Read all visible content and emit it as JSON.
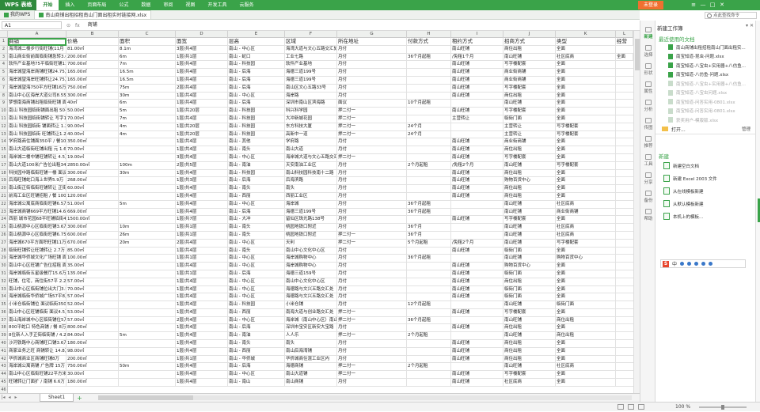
{
  "app": {
    "logo": "WPS 表格",
    "menu": [
      "开始",
      "插入",
      "页面布局",
      "公式",
      "数据",
      "审阅",
      "视图",
      "开发工具",
      "云服务"
    ],
    "active_menu": "开始",
    "login_label": "未登录",
    "window_controls": [
      "≡",
      "—",
      "□",
      "✕"
    ]
  },
  "tabs": [
    {
      "label": "我的WPS"
    },
    {
      "label": "南山商铺出租招租南山门面出租实时链接网.xlsx"
    }
  ],
  "command_search": {
    "placeholder": "点此查找命令"
  },
  "formula_bar": {
    "cell_ref": "A1",
    "value": "商铺",
    "icons": [
      "⊙",
      "fx"
    ]
  },
  "grid": {
    "columns": [
      "A",
      "B",
      "C",
      "D",
      "E",
      "F",
      "G",
      "H",
      "I",
      "J",
      "K",
      "L"
    ],
    "header_row": [
      "商铺",
      "价格",
      "面积",
      "面宽",
      "层高",
      "区域",
      "所在地址",
      "付款方式",
      "租约方式",
      "招商方式",
      "类型",
      "经营"
    ],
    "rows": [
      [
        "海湾城二楼步行街旺铺(11月",
        "81.00㎡",
        "8.1m",
        "3层/共4层",
        "南山 - 中心区",
        "海湾大道与文心五路交汇处",
        "月付",
        "",
        "南山旺铺",
        "商住出租",
        "全面"
      ],
      [
        "南山商业街前面临街铺急转3.6万",
        "200.00㎡",
        "6m",
        "1层/共1层",
        "南山 - 蛇口",
        "工业七路",
        "月付",
        "36个月起租",
        "/免租1个月",
        "南山旺铺",
        "社区底商",
        "全面"
      ],
      [
        "软件产业基地75平临街旺铺13万",
        "700.00㎡",
        "7m",
        "1层/共4层",
        "南山 - 科技园",
        "软件产业基地",
        "月付",
        "",
        "南山旺铺",
        "写字楼配套",
        "全面"
      ],
      [
        "海岸城望海岸商铺旺铺24.75万",
        "165.00㎡",
        "16.5m",
        "1层/共4层",
        "南山 - 后海",
        "海德三道199号",
        "月付",
        "",
        "南山旺铺",
        "商业街商铺",
        "全面"
      ],
      [
        "海岸城望海岸旺铺转让24.75万",
        "165.00㎡",
        "16.5m",
        "1层/共4层",
        "南山 - 后海",
        "海德三道199号",
        "月付",
        "",
        "南山旺铺",
        "商业街商铺",
        "全面"
      ],
      [
        "海岸城望海750平方旺铺16万",
        "750.00㎡",
        "75m",
        "2层/共4层",
        "南山 - 后海",
        "南山区文心五路33号",
        "月付",
        "",
        "南山旺铺",
        "写字楼配套",
        "全面"
      ],
      [
        "南山中心区海岸大道公司8.55万",
        "300.00㎡",
        "30m",
        "1层/共4层",
        "南山 - 中心区",
        "海岸路",
        "月付",
        "",
        "南山旺铺",
        "商住出租",
        "全面"
      ],
      [
        "梦想南海商铺出租临街旺铺 面议",
        "40㎡",
        "6m",
        "1层/共4层",
        "南山 - 后海",
        "深圳市南山区滨海路",
        "面议",
        "10个月起租",
        "",
        "南山旺铺",
        "全面"
      ],
      [
        "南山 科技园临街铺面出租 50平 2.4万",
        "50.00㎡",
        "5m",
        "1层/共20层",
        "南山 - 科技园",
        "科兴科学园",
        "押二付一",
        "",
        "南山旺铺",
        "写字楼配套",
        "全面"
      ],
      [
        "南山 科技园临街铺转让 写字1.6万",
        "70.00㎡",
        "7m",
        "1层/共4层",
        "南山 - 科技园",
        "大冲新城花园",
        "押二付一",
        "",
        "主营转让",
        "临街门面",
        "全面"
      ],
      [
        "南山 科技园临街 铺面转让 1.2万",
        "90.00㎡",
        "4m",
        "1层/共20层",
        "南山 - 科技园",
        "东方科技大厦",
        "押二付一",
        "24个月",
        "",
        "主营转让",
        "写字楼配套"
      ],
      [
        "南山 科技园临街 旺铺转让1.2万",
        "40.00㎡",
        "4m",
        "1层/共20层",
        "南山 - 科技园",
        "高新中一道",
        "押二付一",
        "24个月",
        "",
        "主营转让",
        "写字楼配套"
      ],
      [
        "学府路商住铺面350平 / 餐10.5万",
        "350.00㎡",
        "",
        "1层/共4层",
        "南山 - 其他",
        "学府路",
        "月付",
        "",
        "南山旺铺",
        "商业街商铺",
        "全面"
      ],
      [
        "南山大道临街旺铺出租 元 1.6万",
        "70.00㎡",
        "",
        "1层/共4层",
        "南山 - 南头",
        "南山大道",
        "月付",
        "",
        "南山旺铺",
        "商住出租",
        "全面"
      ],
      [
        "海岸城二楼中铺旺铺转让 4.5万",
        "19.00㎡",
        "",
        "3层/共4层",
        "南山 - 中心区",
        "海岸城大道与文心五路交汇处",
        "押二付一",
        "",
        "南山旺铺",
        "写字楼配套",
        "全面"
      ],
      [
        "南山大道100米广告位出租34万",
        "2850.00㎡",
        "100m",
        "2层/共5层",
        "南山 - 南油",
        "天安南油工业区",
        "月付",
        "2个月起租",
        "/免租2个月",
        "南山旺铺",
        "写字楼配套"
      ],
      [
        "科技园中路临街旺铺一楼 面议",
        "300.00㎡",
        "30m",
        "1层/共4层",
        "南山 - 科技园",
        "南山科技园科技南十二路",
        "月付",
        "",
        "南山旺铺",
        "商住出租",
        "全面"
      ],
      [
        "后海旺铺蛇口海上世界5.9万",
        "268.00㎡",
        "",
        "1层/共3层",
        "南山 - 后海",
        "后海滨路",
        "月付",
        "",
        "南山旺铺",
        "购物百货中心",
        "全面"
      ],
      [
        "南山街正街临街旺铺转让 正街2万",
        "60.00㎡",
        "",
        "1层/共4层",
        "南山 - 南头",
        "南头",
        "月付",
        "",
        "南山旺铺",
        "商住出租",
        "全面"
      ],
      [
        "前海工业区旺铺招租 / 餐 10000",
        "120.00㎡",
        "",
        "1层/共4层",
        "南山 - 西丽",
        "西丽工业区",
        "月付",
        "",
        "南山旺铺",
        "商住出租",
        "全面"
      ],
      [
        "海岸城公寓底商临街旺铺6.5万",
        "51.00㎡",
        "5m",
        "1层/共4层",
        "南山 - 中心区",
        "海岸城",
        "月付",
        "36个月起租",
        "",
        "南山旺铺",
        "社区底商"
      ],
      [
        "海岸城商铺669平方旺铺14.65万",
        "669.00㎡",
        "",
        "1层/共4层",
        "南山 - 后海",
        "海德三道199号",
        "月付",
        "36个月起租",
        "",
        "南山旺铺",
        "商业街商铺"
      ],
      [
        "西丽 城市花园68平旺铺临街4.5万",
        "1500.00㎡",
        "",
        "1层/共7层",
        "南山 - 大冲",
        "留仙区珠光路138号",
        "月付",
        "",
        "南山旺铺",
        "写字楼配套",
        "全面"
      ],
      [
        "南山桃源中心区临街旺铺3.6万",
        "300.00㎡",
        "10m",
        "1层/共1层",
        "南山 - 南头",
        "桃园地铁口附近",
        "月付",
        "36个月",
        "",
        "南山旺铺",
        "社区底商"
      ],
      [
        "南山桃源中心区临街旺铺6.75万",
        "600.00㎡",
        "26m",
        "1层/共1层",
        "南山 - 南头",
        "桃园地铁口附近",
        "押二付一",
        "36个月",
        "",
        "南山旺铺",
        "社区底商"
      ],
      [
        "海岸城670平方面积旺铺11万",
        "670.00㎡",
        "20m",
        "2层/共4层",
        "南山 - 中心区",
        "天利",
        "押二付一",
        "5个月起租",
        "/免租2个月",
        "南山旺铺",
        "写字楼配套"
      ],
      [
        "临街旺铺转让旺铺转让 2.7万",
        "85.00㎡",
        "",
        "1层/共4层",
        "南山 - 南头",
        "南山中心文化中心区",
        "月付",
        "",
        "南山旺铺",
        "临街门面",
        "全面"
      ],
      [
        "海岸城华侨城文化广场旺铺 面议",
        "100.00㎡",
        "",
        "1层/共1层",
        "南山 - 中心区",
        "海岸城购物中心",
        "月付",
        "36个月起租",
        "",
        "南山旺铺",
        "购物百货中心"
      ],
      [
        "南山中心区旺铺广告位招租 面议",
        "35.00㎡",
        "",
        "1层/共4层",
        "南山 - 中心区",
        "海岸城购物中心",
        "月付",
        "",
        "南山旺铺",
        "购物百货中心",
        "全面"
      ],
      [
        "海岸城临街五星级餐厅15.6万",
        "135.00㎡",
        "",
        "1层/共1层",
        "南山 - 后海",
        "海德三道159号",
        "月付",
        "",
        "南山旺铺",
        "临街门面",
        "全面"
      ],
      [
        "旺铺，住宅，商住街57平 2.2万",
        "57.00㎡",
        "",
        "1层/共4层",
        "南山 - 中心区",
        "南山中心文化中心区",
        "月付",
        "",
        "南山旺铺",
        "商住出租",
        "全面"
      ],
      [
        "南山中心区临街铺位出大门3.5万",
        "70.00㎡",
        "",
        "1层/共4层",
        "南山 - 中心区",
        "海德路与文兴五路交汇处",
        "月付",
        "",
        "南山旺铺",
        "临街门面",
        "全面"
      ],
      [
        "海岸城临街华侨城广场57平8万",
        "57.00㎡",
        "",
        "1层/共4层",
        "南山 - 中心区",
        "海德路与文兴五路交汇处",
        "月付",
        "",
        "南山旺铺",
        "临街门面",
        "全面"
      ],
      [
        "小米仓临街铺位 面议临街3500",
        "52.00㎡",
        "",
        "1层/共4层",
        "南山 - 科技园",
        "小米仓铺",
        "月付",
        "12个月起租",
        "",
        "南山旺铺",
        "临街门面"
      ],
      [
        "南山中心区旺铺临街 面议4.5万",
        "53.00㎡",
        "",
        "1层/共4层",
        "南山 - 西丽",
        "南海大道与创业路交汇处",
        "押二付一",
        "",
        "南山旺铺",
        "写字楼配套",
        "全面"
      ],
      [
        "南山海岸城中心区临街铺位5万",
        "57.00㎡",
        "",
        "2层/共4层",
        "南山 - 中心区",
        "海岸城（南山中心区）南山商",
        "押二付一",
        "36个月起租",
        "",
        "南山旺铺",
        "商住出租"
      ],
      [
        "800平蛇口 特色商铺 / 餐 8万",
        "800.00㎡",
        "",
        "1层/共4层",
        "南山 - 后海",
        "深圳市宝安区新安大宝路",
        "月付",
        "",
        "南山旺铺",
        "商住出租",
        "全面"
      ],
      [
        "8位新人入手正街临街铺 / 4.2万",
        "84.00㎡",
        "5m",
        "1层/共4层",
        "南山 - 南油",
        "人人乐",
        "押二付一",
        "2个月起租",
        "",
        "南山旺铺",
        "商住出租"
      ],
      [
        "沙河铁路中心商铺旺口铺3.6万",
        "180.00㎡",
        "",
        "1层/共4层",
        "南山 - 南头",
        "南头",
        "月付",
        "",
        "南山旺铺",
        "商住出租",
        "全面"
      ],
      [
        "商家业务之旺 商铺转让 14.8万",
        "98.00㎡",
        "",
        "1层/共4层",
        "南山 - 西丽",
        "南山后海湾铺",
        "月付",
        "",
        "南山旺铺",
        "商住出租",
        "全面"
      ],
      [
        "华侨城商业区商铺旺铺8万",
        "200.00㎡",
        "",
        "1层/共1层",
        "南山 - 华侨城",
        "华侨城商住混工业区内",
        "月付",
        "",
        "南山旺铺",
        "商住出租",
        "全面"
      ],
      [
        "海岸城公寓商铺 广告牌 15万",
        "750.00㎡",
        "50m",
        "1层/共4层",
        "南山 - 后海",
        "海德商铺",
        "押二付一",
        "2个月起租",
        "",
        "南山旺铺",
        "社区底商"
      ],
      [
        "南山中心区临街旺铺22平方米",
        "30.00㎡",
        "",
        "1层/共4层",
        "南山 - 中心区",
        "南山大道铺",
        "押二付一",
        "",
        "南山旺铺",
        "写字楼配套",
        "全面"
      ],
      [
        "旺铺转让门面扩 / 南铺 6.6万",
        "180.00㎡",
        "",
        "1层/共4层",
        "南山 - 南山",
        "南山商铺",
        "月付",
        "",
        "南山旺铺",
        "社区底商",
        "全面"
      ]
    ],
    "row_numbers": [
      "1",
      "2",
      "3",
      "4",
      "5",
      "6",
      "7",
      "8",
      "9",
      "10",
      "11",
      "12",
      "13",
      "14",
      "15",
      "16",
      "17",
      "18",
      "19",
      "20",
      "21",
      "22",
      "23",
      "24",
      "25",
      "26",
      "27",
      "28",
      "29",
      "30",
      "31",
      "32",
      "33",
      "34",
      "35",
      "36",
      "37",
      "38",
      "39",
      "40",
      "41",
      "42",
      "43",
      "44",
      "45",
      "46"
    ]
  },
  "sheet_tabs": [
    "Sheet1"
  ],
  "status_bar": {
    "zoom": "100 %",
    "zoom_minus": "-",
    "zoom_plus": "+"
  },
  "side_toolbar": [
    "新建",
    "选择",
    "形状",
    "属性",
    "分析",
    "传图",
    "推荐",
    "工具",
    "分享",
    "备份",
    "帮助"
  ],
  "task_panel": {
    "title": "新建工作簿",
    "recent_title": "最近使用的文档",
    "recent_files": [
      {
        "name": "南山商铺出租招租南山门面出租实...",
        "dim": false
      },
      {
        "name": "南宝知道-昆虫-问题.xlsx",
        "dim": false
      },
      {
        "name": "南宝知道-八宝虫+实用器+八仿鱼...",
        "dim": false
      },
      {
        "name": "南宝知道-八仿鱼-问题.xlsx",
        "dim": false
      },
      {
        "name": "南宝知道-八宝虫+实用器+八仿鱼...",
        "dim": true
      },
      {
        "name": "南宝知道-八宝虫问题.xlsx",
        "dim": true
      },
      {
        "name": "南宝知道-问答实用-0801.xlsx",
        "dim": true
      },
      {
        "name": "南宝知道-问答实用-0801.xlsx",
        "dim": true
      },
      {
        "name": "获奖用户-模版版.xlsx",
        "dim": true
      }
    ],
    "open_label": "打开...",
    "manage_label": "管理",
    "new_title": "新建",
    "new_items": [
      "新建空白文档",
      "新建 Excel 2003 文件",
      "从在线模板新建",
      "从默认模板新建",
      "本机上的模板..."
    ],
    "ime_label": "中"
  }
}
